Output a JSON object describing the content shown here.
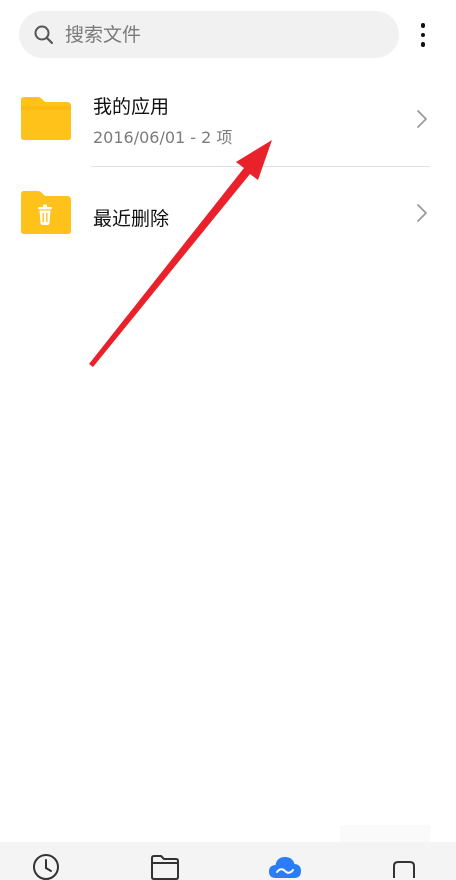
{
  "search": {
    "placeholder": "搜索文件",
    "icon": "search-icon"
  },
  "menu": {
    "icon": "more-vertical-icon"
  },
  "items": [
    {
      "title": "我的应用",
      "subtitle": "2016/06/01 - 2 项",
      "icon": "folder-icon"
    },
    {
      "title": "最近删除",
      "subtitle": "",
      "icon": "trash-folder-icon"
    }
  ],
  "bottom_nav": [
    {
      "icon": "recent-clock-icon",
      "active": false
    },
    {
      "icon": "browse-folder-icon",
      "active": false
    },
    {
      "icon": "cloud-icon",
      "active": true
    },
    {
      "icon": "more-tab-icon",
      "active": false
    }
  ],
  "colors": {
    "folder": "#FFC21A",
    "folder_tab": "#F7B000",
    "accent": "#2A7DF6",
    "arrow": "#E8212B"
  }
}
